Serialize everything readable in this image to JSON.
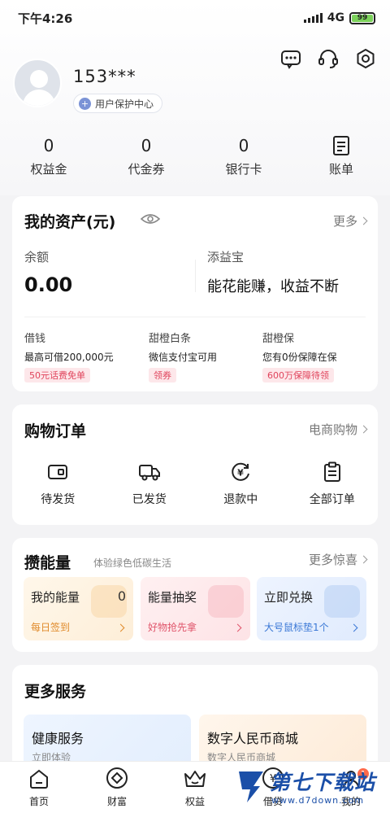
{
  "status": {
    "time": "下午4:26",
    "network": "4G",
    "battery": "99"
  },
  "profile": {
    "username": "153***",
    "protect_label": "用户保护中心"
  },
  "stats": [
    {
      "value": "0",
      "label": "权益金"
    },
    {
      "value": "0",
      "label": "代金券"
    },
    {
      "value": "0",
      "label": "银行卡"
    },
    {
      "label": "账单",
      "icon": "bill-icon"
    }
  ],
  "assets": {
    "title": "我的资产(元)",
    "more": "更多",
    "balance_label": "余额",
    "balance_value": "0.00",
    "tianyi_label": "添益宝",
    "tianyi_desc": "能花能赚，收益不断",
    "items": [
      {
        "title": "借钱",
        "desc": "最高可借200,000元",
        "tag": "50元话费免单"
      },
      {
        "title": "甜橙白条",
        "desc": "微信支付宝可用",
        "tag": "领券"
      },
      {
        "title": "甜橙保",
        "desc": "您有0份保障在保",
        "tag": "600万保障待领"
      }
    ]
  },
  "orders": {
    "title": "购物订单",
    "more": "电商购物",
    "items": [
      {
        "label": "待发货",
        "icon": "wallet-icon"
      },
      {
        "label": "已发货",
        "icon": "truck-icon"
      },
      {
        "label": "退款中",
        "icon": "refund-icon"
      },
      {
        "label": "全部订单",
        "icon": "clipboard-icon"
      }
    ]
  },
  "energy": {
    "title": "攒能量",
    "subtitle": "体验绿色低碳生活",
    "more": "更多惊喜",
    "tiles": [
      {
        "title": "我的能量",
        "value": "0",
        "sub": "每日签到",
        "color": "#e08a2a"
      },
      {
        "title": "能量抽奖",
        "sub": "好物抢先拿",
        "color": "#e0556b"
      },
      {
        "title": "立即兑换",
        "sub": "大号鼠标垫1个",
        "color": "#3a78d6"
      }
    ]
  },
  "services": {
    "title": "更多服务",
    "tiles": [
      {
        "title": "健康服务",
        "sub": "立即体验"
      },
      {
        "title": "数字人民币商城",
        "sub": "数字人民币商城"
      }
    ]
  },
  "tabs": [
    {
      "label": "首页",
      "icon": "home-icon"
    },
    {
      "label": "财富",
      "icon": "wealth-icon"
    },
    {
      "label": "权益",
      "icon": "crown-icon"
    },
    {
      "label": "借贷",
      "icon": "loan-icon"
    },
    {
      "label": "我的",
      "icon": "profile-icon",
      "badge": "1"
    }
  ],
  "watermark": {
    "title": "第七下载站",
    "url": "www.d7down.com"
  }
}
